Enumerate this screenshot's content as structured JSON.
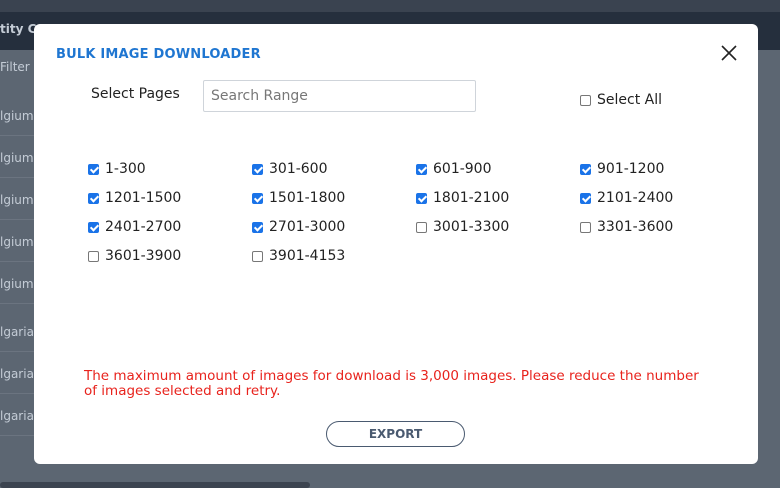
{
  "background": {
    "header_fragment": "tity Co",
    "filter_fragment": "Filter",
    "row_fragments": [
      "lgium",
      "lgium",
      "lgium",
      "lgium",
      "lgium",
      "lgaria",
      "lgaria",
      "lgaria"
    ]
  },
  "modal": {
    "title": "BULK IMAGE DOWNLOADER",
    "select_pages_label": "Select Pages",
    "search_placeholder": "Search Range",
    "select_all_label": "Select All",
    "select_all_checked": false,
    "ranges": [
      {
        "label": "1-300",
        "checked": true
      },
      {
        "label": "301-600",
        "checked": true
      },
      {
        "label": "601-900",
        "checked": true
      },
      {
        "label": "901-1200",
        "checked": true
      },
      {
        "label": "1201-1500",
        "checked": true
      },
      {
        "label": "1501-1800",
        "checked": true
      },
      {
        "label": "1801-2100",
        "checked": true
      },
      {
        "label": "2101-2400",
        "checked": true
      },
      {
        "label": "2401-2700",
        "checked": true
      },
      {
        "label": "2701-3000",
        "checked": true
      },
      {
        "label": "3001-3300",
        "checked": false
      },
      {
        "label": "3301-3600",
        "checked": false
      },
      {
        "label": "3601-3900",
        "checked": false
      },
      {
        "label": "3901-4153",
        "checked": false
      }
    ],
    "error_message": "The maximum amount of images for download is 3,000 images. Please reduce the number of images selected and retry.",
    "export_label": "EXPORT"
  },
  "colors": {
    "title": "#1f76d1",
    "error": "#e8231d",
    "checkbox_checked": "#1a73e8",
    "overlay": "#5c6672"
  },
  "icons": {
    "close": "close-icon"
  }
}
